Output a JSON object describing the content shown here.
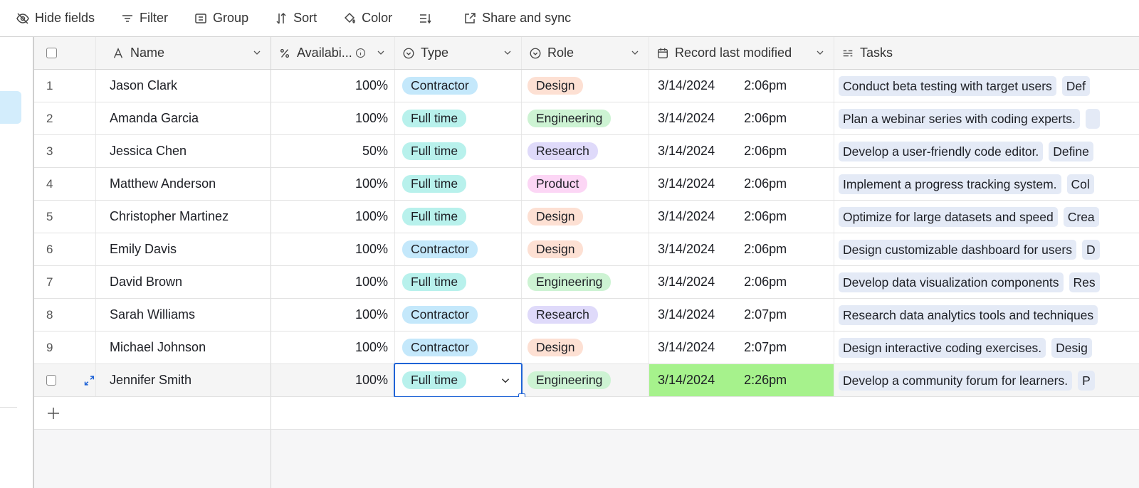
{
  "toolbar": [
    {
      "icon": "eye-off-icon",
      "label": "Hide fields"
    },
    {
      "icon": "filter-icon",
      "label": "Filter"
    },
    {
      "icon": "group-icon",
      "label": "Group"
    },
    {
      "icon": "sort-icon",
      "label": "Sort"
    },
    {
      "icon": "paint-bucket-icon",
      "label": "Color"
    },
    {
      "icon": "row-height-icon",
      "label": ""
    },
    {
      "icon": "share-icon",
      "label": "Share and sync"
    }
  ],
  "columns": [
    {
      "icon": "text-type-icon",
      "label": "Name"
    },
    {
      "icon": "percent-icon",
      "label": "Availabi..."
    },
    {
      "icon": "single-select-icon",
      "label": "Type"
    },
    {
      "icon": "single-select-icon",
      "label": "Role"
    },
    {
      "icon": "calendar-edit-icon",
      "label": "Record last modified"
    },
    {
      "icon": "linked-list-icon",
      "label": "Tasks"
    }
  ],
  "colors": {
    "Contractor": "#c4e8fb",
    "Full time": "#b8f1ec",
    "Design": "#fde0d3",
    "Engineering": "#cdf3d3",
    "Research": "#dfdafa",
    "Product": "#fcd6f5",
    "highlight": "#a6f28c",
    "active": "#1f63d6"
  },
  "rows": [
    {
      "n": "1",
      "name": "Jason Clark",
      "avail": "100%",
      "type": "Contractor",
      "role": "Design",
      "date": "3/14/2024",
      "time": "2:06pm",
      "tasks": [
        "Conduct beta testing with target users",
        "Def"
      ]
    },
    {
      "n": "2",
      "name": "Amanda Garcia",
      "avail": "100%",
      "type": "Full time",
      "role": "Engineering",
      "date": "3/14/2024",
      "time": "2:06pm",
      "tasks": [
        "Plan a webinar series with coding experts.",
        ""
      ]
    },
    {
      "n": "3",
      "name": "Jessica Chen",
      "avail": "50%",
      "type": "Full time",
      "role": "Research",
      "date": "3/14/2024",
      "time": "2:06pm",
      "tasks": [
        "Develop a user-friendly code editor.",
        "Define"
      ]
    },
    {
      "n": "4",
      "name": "Matthew Anderson",
      "avail": "100%",
      "type": "Full time",
      "role": "Product",
      "date": "3/14/2024",
      "time": "2:06pm",
      "tasks": [
        "Implement a progress tracking system.",
        "Col"
      ]
    },
    {
      "n": "5",
      "name": "Christopher Martinez",
      "avail": "100%",
      "type": "Full time",
      "role": "Design",
      "date": "3/14/2024",
      "time": "2:06pm",
      "tasks": [
        "Optimize for large datasets and speed",
        "Crea"
      ]
    },
    {
      "n": "6",
      "name": "Emily Davis",
      "avail": "100%",
      "type": "Contractor",
      "role": "Design",
      "date": "3/14/2024",
      "time": "2:06pm",
      "tasks": [
        "Design customizable dashboard for users",
        "D"
      ]
    },
    {
      "n": "7",
      "name": "David Brown",
      "avail": "100%",
      "type": "Full time",
      "role": "Engineering",
      "date": "3/14/2024",
      "time": "2:06pm",
      "tasks": [
        "Develop data visualization components",
        "Res"
      ]
    },
    {
      "n": "8",
      "name": "Sarah Williams",
      "avail": "100%",
      "type": "Contractor",
      "role": "Research",
      "date": "3/14/2024",
      "time": "2:07pm",
      "tasks": [
        "Research data analytics tools and techniques"
      ]
    },
    {
      "n": "9",
      "name": "Michael Johnson",
      "avail": "100%",
      "type": "Contractor",
      "role": "Design",
      "date": "3/14/2024",
      "time": "2:07pm",
      "tasks": [
        "Design interactive coding exercises.",
        "Desig"
      ]
    },
    {
      "n": "",
      "name": "Jennifer Smith",
      "avail": "100%",
      "type": "Full time",
      "role": "Engineering",
      "date": "3/14/2024",
      "time": "2:26pm",
      "tasks": [
        "Develop a community forum for learners.",
        "P"
      ],
      "selected": true
    }
  ]
}
